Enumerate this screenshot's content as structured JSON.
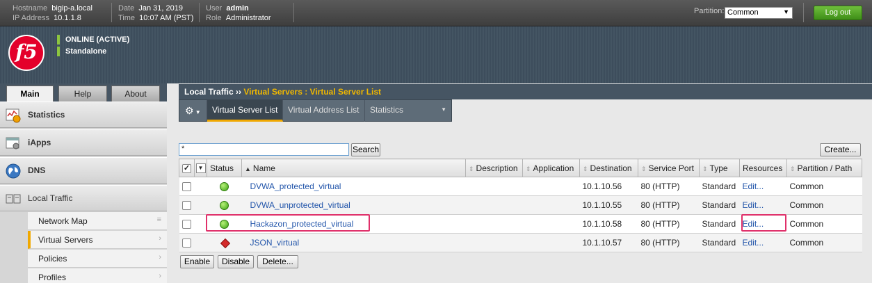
{
  "topbar": {
    "hostname_label": "Hostname",
    "hostname": "bigip-a.local",
    "ip_label": "IP Address",
    "ip": "10.1.1.8",
    "date_label": "Date",
    "date": "Jan 31, 2019",
    "time_label": "Time",
    "time": "10:07 AM (PST)",
    "user_label": "User",
    "user": "admin",
    "role_label": "Role",
    "role": "Administrator",
    "partition_label": "Partition:",
    "partition_value": "Common",
    "logout_label": "Log out"
  },
  "header": {
    "logo_text": "f5",
    "status_online": "ONLINE (ACTIVE)",
    "status_mode": "Standalone"
  },
  "left_tabs": [
    "Main",
    "Help",
    "About"
  ],
  "nav": {
    "sections": [
      {
        "label": "Statistics",
        "icon": "statistics-chart-icon"
      },
      {
        "label": "iApps",
        "icon": "iapps-icon"
      },
      {
        "label": "DNS",
        "icon": "globe-icon"
      },
      {
        "label": "Local Traffic",
        "icon": "local-traffic-icon"
      }
    ],
    "local_traffic_items": [
      "Network Map",
      "Virtual Servers",
      "Policies",
      "Profiles"
    ]
  },
  "breadcrumb": {
    "section": "Local Traffic",
    "separator": "››",
    "page": "Virtual Servers : Virtual Server List"
  },
  "menu": {
    "gear_icon": "gear-icon",
    "items": [
      "Virtual Server List",
      "Virtual Address List",
      "Statistics"
    ]
  },
  "search": {
    "value": "*",
    "button": "Search"
  },
  "create_button": "Create...",
  "table": {
    "headers": {
      "status": "Status",
      "name": "Name",
      "description": "Description",
      "application": "Application",
      "destination": "Destination",
      "service_port": "Service Port",
      "type": "Type",
      "resources": "Resources",
      "partition": "Partition / Path"
    },
    "rows": [
      {
        "status": "available",
        "name": "DVWA_protected_virtual",
        "description": "",
        "application": "",
        "destination": "10.1.10.56",
        "service_port": "80 (HTTP)",
        "type": "Standard",
        "resources": "Edit...",
        "partition": "Common"
      },
      {
        "status": "available",
        "name": "DVWA_unprotected_virtual",
        "description": "",
        "application": "",
        "destination": "10.1.10.55",
        "service_port": "80 (HTTP)",
        "type": "Standard",
        "resources": "Edit...",
        "partition": "Common"
      },
      {
        "status": "available",
        "name": "Hackazon_protected_virtual",
        "description": "",
        "application": "",
        "destination": "10.1.10.58",
        "service_port": "80 (HTTP)",
        "type": "Standard",
        "resources": "Edit...",
        "partition": "Common"
      },
      {
        "status": "offline",
        "name": "JSON_virtual",
        "description": "",
        "application": "",
        "destination": "10.1.10.57",
        "service_port": "80 (HTTP)",
        "type": "Standard",
        "resources": "Edit...",
        "partition": "Common"
      }
    ]
  },
  "actions": [
    "Enable",
    "Disable",
    "Delete..."
  ],
  "colors": {
    "accent_orange": "#f0a800",
    "status_green": "#3aa312",
    "status_red": "#d42a2a",
    "highlight_box": "#e0306a",
    "logout_green": "#4e9e22"
  }
}
